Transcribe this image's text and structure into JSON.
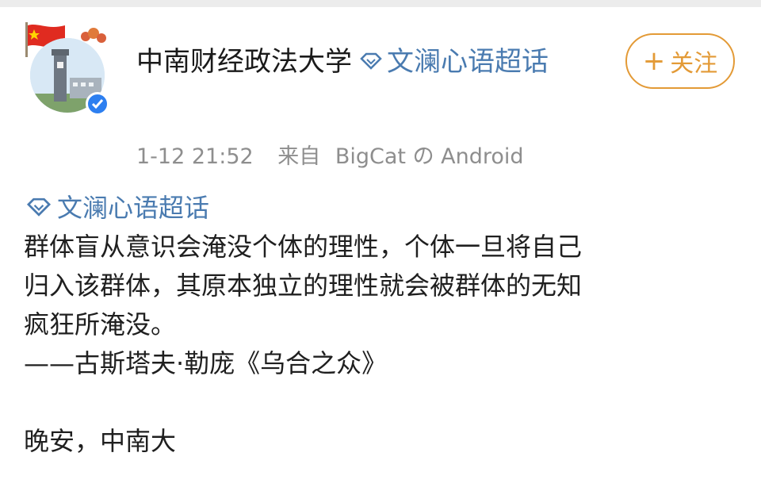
{
  "post": {
    "author_name": "中南财经政法大学",
    "author_topic": "文澜心语超话",
    "follow_label": "关注",
    "follow_prefix": "+",
    "timestamp": "1-12 21:52",
    "source_prefix": "来自",
    "source": "BigCat の Android",
    "content_topic": "文澜心语超话",
    "content_lines": [
      "群体盲从意识会淹没个体的理性，个体一旦将自己",
      "归入该群体，其原本独立的理性就会被群体的无知",
      "疯狂所淹没。",
      "——古斯塔夫·勒庞《乌合之众》",
      "晚安，中南大"
    ]
  },
  "colors": {
    "topic_blue": "#4a7bb0",
    "follow_orange": "#e39a36",
    "meta_gray": "#8e8e8e",
    "verified_blue": "#2d7ff0"
  },
  "icons": [
    "avatar",
    "verified-icon",
    "supertopic-diamond-icon"
  ]
}
